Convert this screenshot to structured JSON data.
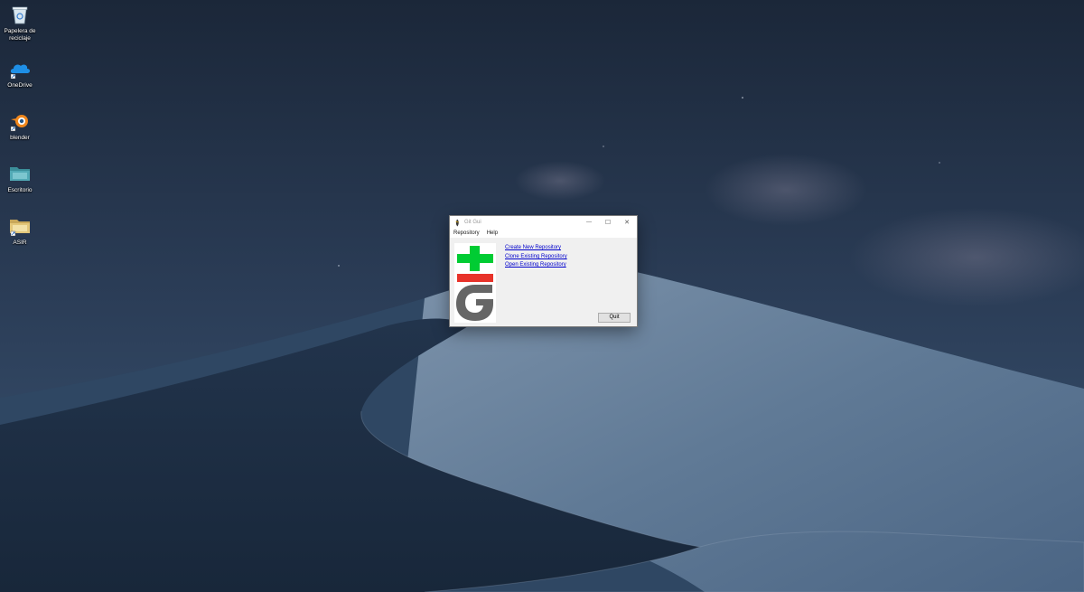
{
  "desktop": {
    "icons": [
      {
        "label": "Papelera de reciclaje",
        "icon": "recycle-bin-icon"
      },
      {
        "label": "OneDrive",
        "icon": "onedrive-cloud-icon"
      },
      {
        "label": "blender",
        "icon": "blender-icon"
      },
      {
        "label": "Escritorio",
        "icon": "folder-icon"
      },
      {
        "label": "ASIR",
        "icon": "folder-icon"
      }
    ]
  },
  "window": {
    "title": "Git Gui",
    "controls": {
      "minimize": "—",
      "maximize": "☐",
      "close": "✕"
    },
    "menu": [
      "Repository",
      "Help"
    ],
    "links": {
      "create": "Create New Repository",
      "clone": "Clone Existing Repository",
      "open": "Open Existing Repository"
    },
    "quit_label": "Quit"
  },
  "colors": {
    "logo_green": "#00cc33",
    "logo_red": "#e8332a",
    "logo_gray": "#666666",
    "link_blue": "#0000cc"
  }
}
